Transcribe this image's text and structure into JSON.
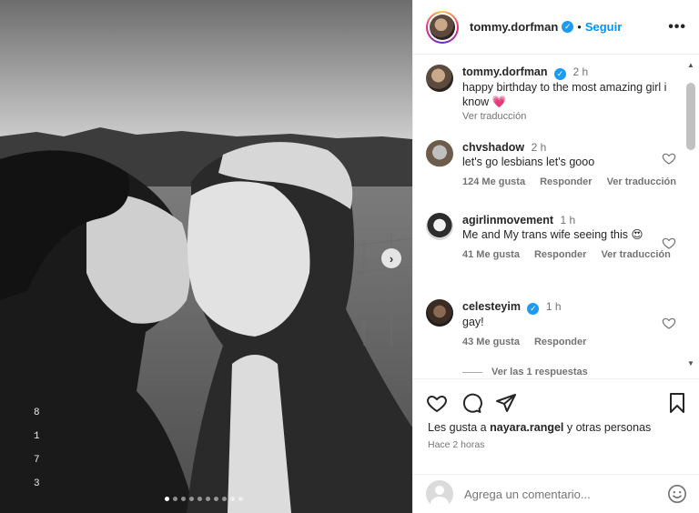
{
  "post": {
    "author": "tommy.dorfman",
    "follow_label": "Seguir",
    "separator": "•",
    "more_label": "•••",
    "carousel": {
      "total_slides": 10,
      "active_index": 0,
      "next_symbol": "›"
    },
    "side_digits": [
      "8",
      "1",
      "7",
      "3"
    ]
  },
  "caption": {
    "username": "tommy.dorfman",
    "time": "2 h",
    "text": "happy birthday to the most amazing girl i know 💗",
    "translate": "Ver traducción"
  },
  "comments": [
    {
      "username": "chvshadow",
      "time": "2 h",
      "text": "let's go lesbians let's gooo",
      "likes": "124 Me gusta",
      "reply": "Responder",
      "translate": "Ver traducción",
      "verified": false
    },
    {
      "username": "agirlinmovement",
      "time": "1 h",
      "text": "Me and My trans wife seeing this 😍",
      "likes": "41 Me gusta",
      "reply": "Responder",
      "translate": "Ver traducción",
      "verified": false
    },
    {
      "username": "celesteyim",
      "time": "1 h",
      "text": "gay!",
      "likes": "43 Me gusta",
      "reply": "Responder",
      "translate": "",
      "verified": true
    }
  ],
  "replies_link": "Ver las 1 respuestas",
  "likes_line": {
    "prefix": "Les gusta a ",
    "user": "nayara.rangel",
    "suffix": " y otras personas"
  },
  "posted_ago": "Hace 2 horas",
  "add_comment": {
    "placeholder": "Agrega un comentario..."
  },
  "colors": {
    "accent": "#0095f6",
    "verified": "#1d9bf0",
    "muted": "#737373"
  }
}
